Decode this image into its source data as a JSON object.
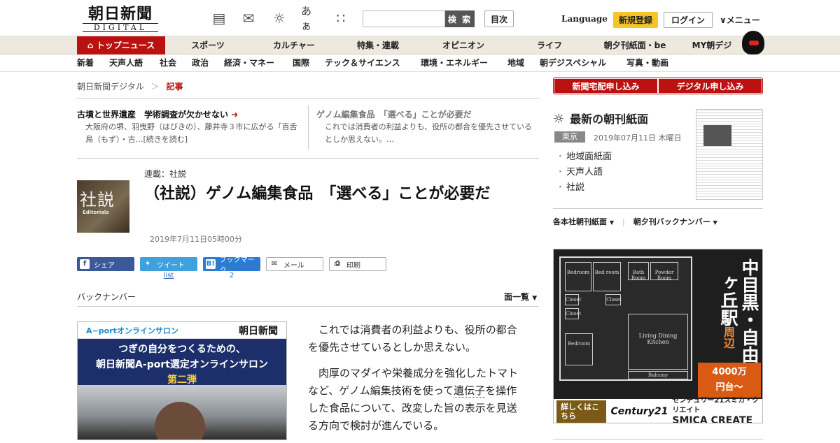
{
  "header": {
    "logo_ja": "朝日新聞",
    "logo_en": "DIGITAL",
    "icons": [
      "newspaper-icon",
      "megaphone-icon",
      "weather-icon",
      "font-size-icon",
      "grid-icon"
    ],
    "font_size_label": "あぁ",
    "search_placeholder": "",
    "search_button": "検 索",
    "mokuji": "目次",
    "language": "Language",
    "register": "新規登録",
    "login": "ログイン",
    "menu": "メニュー"
  },
  "nav1": [
    "トップニュース",
    "スポーツ",
    "カルチャー",
    "特集・連載",
    "オピニオン",
    "ライフ",
    "朝夕刊紙面・be",
    "MY朝デジ"
  ],
  "nav2": [
    "新着",
    "天声人語",
    "社会",
    "政治",
    "経済・マネー",
    "国際",
    "テック＆サイエンス",
    "環境・エネルギー",
    "地域",
    "朝デジスペシャル",
    "写真・動画"
  ],
  "breadcrumb": {
    "home": "朝日新聞デジタル",
    "sep": "＞",
    "current": "記事"
  },
  "related": [
    {
      "title": "古墳と世界遺産　学術調査が欠かせない",
      "snippet": "大阪府の堺、羽曳野（はびきの）、藤井寺３市に広がる「百舌鳥（もず）・古…[続きを読む]"
    },
    {
      "title": "ゲノム編集食品　「選べる」ことが必要だ",
      "snippet": "これでは消費者の利益よりも、役所の都合を優先させているとしか思えない。…"
    }
  ],
  "article": {
    "thumb_kanji": "社説",
    "thumb_en": "Editorials",
    "series": "連載：社説",
    "title": "（社説）ゲノム編集食品　「選べる」ことが必要だ",
    "date": "2019年7月11日05時00分"
  },
  "share": {
    "facebook": "シェア",
    "twitter": "ツイート",
    "hatena": "ブックマーク",
    "mail": "メール",
    "print": "印刷",
    "twitter_count": "list",
    "hatena_count": "2"
  },
  "backnumber": "バックナンバー",
  "menlist": "面一覧",
  "ad_left": {
    "brand": "A−portオンラインサロン",
    "asahi": "朝日新聞",
    "line1": "つぎの自分をつくるための、",
    "line2": "朝日新聞A-port選定オンラインサロン",
    "line3": "第二弾"
  },
  "body": {
    "p1": "これでは消費者の利益よりも、役所の都合を優先させているとしか思えない。",
    "p2a": "肉厚のマダイや栄養成分を強化したトマトなど、ゲノム編集技術を使って",
    "p2link": "遺伝子",
    "p2b": "を操作した食品について、改変した旨の表示を見送る方向で検討が進んでいる。"
  },
  "right": {
    "btn1": "新聞宅配申し込み",
    "btn2": "デジタル申し込み",
    "paper_title": "最新の朝刊紙面",
    "region": "東京",
    "paper_date": "2019年07月11日 木曜日",
    "paper_links": [
      "地域面紙面",
      "天声人語",
      "社説"
    ],
    "link1": "各本社朝刊紙面",
    "link2": "朝夕刊バックナンバー"
  },
  "ad_right": {
    "rooms": [
      "Bedroom",
      "Bed room",
      "Bath Room",
      "Powder Room",
      "Closet",
      "Closet",
      "Closet",
      "Bedroom",
      "Living Dining Kitchen",
      "Balcony"
    ],
    "headline": "中目黒・自由ヶ丘駅",
    "area_suffix": "周辺",
    "price1": "4000万",
    "price2": "円台〜",
    "detail": "詳しくはこちら",
    "century": "Century21",
    "company_ja": "センチュリー21スミカ・クリエイト",
    "company_en": "SMICA CREATE"
  },
  "colors": {
    "accent": "#bb1111",
    "nav_bg": "#eee9df",
    "register": "#f5c52a",
    "facebook": "#3b5998",
    "twitter": "#3ea0dc",
    "hatena": "#2c7bd1"
  }
}
